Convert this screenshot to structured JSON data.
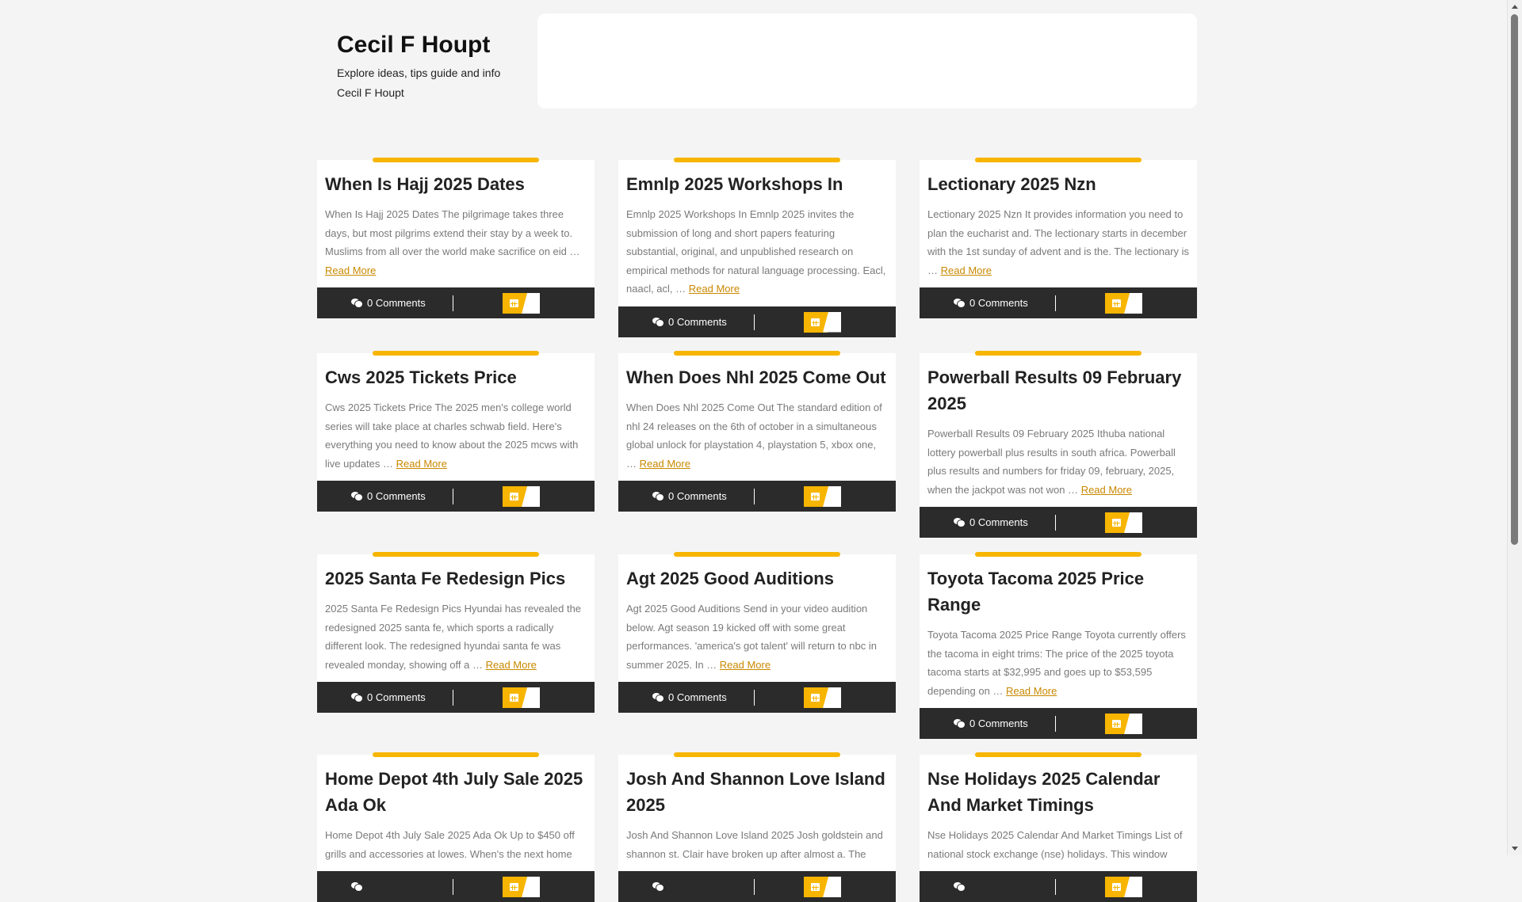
{
  "site": {
    "title": "Cecil F Houpt",
    "tagline": "Explore ideas, tips guide and info Cecil F Houpt"
  },
  "colors": {
    "accent": "#f7b500",
    "footer_bg": "#2b2b2b",
    "page_bg": "#f4f4f4"
  },
  "posts": [
    {
      "title": "When Is Hajj 2025 Dates",
      "excerpt": "When Is Hajj 2025 Dates The pilgrimage takes three days, but most pilgrims extend their stay by a week to. Muslims from all over the world make sacrifice on eid …",
      "read_more": "Read More",
      "comments": "0 Comments"
    },
    {
      "title": "Emnlp 2025 Workshops In",
      "excerpt": "Emnlp 2025 Workshops In Emnlp 2025 invites the submission of long and short papers featuring substantial, original, and unpublished research on empirical methods for natural language processing. Eacl, naacl, acl, …",
      "read_more": "Read More",
      "comments": "0 Comments"
    },
    {
      "title": "Lectionary 2025 Nzn",
      "excerpt": "Lectionary 2025 Nzn It provides information you need to plan the eucharist and. The lectionary starts in december with the 1st sunday of advent and is the. The lectionary is …",
      "read_more": "Read More",
      "comments": "0 Comments"
    },
    {
      "title": "Cws 2025 Tickets Price",
      "excerpt": "Cws 2025 Tickets Price The 2025 men's college world series will take place at charles schwab field. Here's everything you need to know about the 2025 mcws with live updates …",
      "read_more": "Read More",
      "comments": "0 Comments"
    },
    {
      "title": "When Does Nhl 2025 Come Out",
      "excerpt": "When Does Nhl 2025 Come Out The standard edition of nhl 24 releases on the 6th of october in a simultaneous global unlock for playstation 4, playstation 5, xbox one, …",
      "read_more": "Read More",
      "comments": "0 Comments"
    },
    {
      "title": "Powerball Results 09 February 2025",
      "excerpt": "Powerball Results 09 February 2025 Ithuba national lottery powerball plus results in south africa. Powerball plus results and numbers for friday 09, february, 2025, when the jackpot was not won …",
      "read_more": "Read More",
      "comments": "0 Comments"
    },
    {
      "title": "2025 Santa Fe Redesign Pics",
      "excerpt": "2025 Santa Fe Redesign Pics Hyundai has revealed the redesigned 2025 santa fe, which sports a radically different look. The redesigned hyundai santa fe was revealed monday, showing off a …",
      "read_more": "Read More",
      "comments": "0 Comments"
    },
    {
      "title": "Agt 2025 Good Auditions",
      "excerpt": "Agt 2025 Good Auditions Send in your video audition below. Agt season 19 kicked off with some great performances. 'america's got talent' will return to nbc in summer 2025. In …",
      "read_more": "Read More",
      "comments": "0 Comments"
    },
    {
      "title": "Toyota Tacoma 2025 Price Range",
      "excerpt": "Toyota Tacoma 2025 Price Range Toyota currently offers the tacoma in eight trims: The price of the 2025 toyota tacoma starts at $32,995 and goes up to $53,595 depending on …",
      "read_more": "Read More",
      "comments": "0 Comments"
    },
    {
      "title": "Home Depot 4th July Sale 2025 Ada Ok",
      "excerpt": "Home Depot 4th July Sale 2025 Ada Ok Up to $450 off grills and accessories at lowes. When's the next home",
      "read_more": "",
      "comments": ""
    },
    {
      "title": "Josh And Shannon Love Island 2025",
      "excerpt": "Josh And Shannon Love Island 2025 Josh goldstein and shannon st. Clair have broken up after almost a. The",
      "read_more": "",
      "comments": ""
    },
    {
      "title": "Nse Holidays 2025 Calendar And Market Timings",
      "excerpt": "Nse Holidays 2025 Calendar And Market Timings List of national stock exchange (nse) holidays. This window",
      "read_more": "",
      "comments": ""
    }
  ]
}
